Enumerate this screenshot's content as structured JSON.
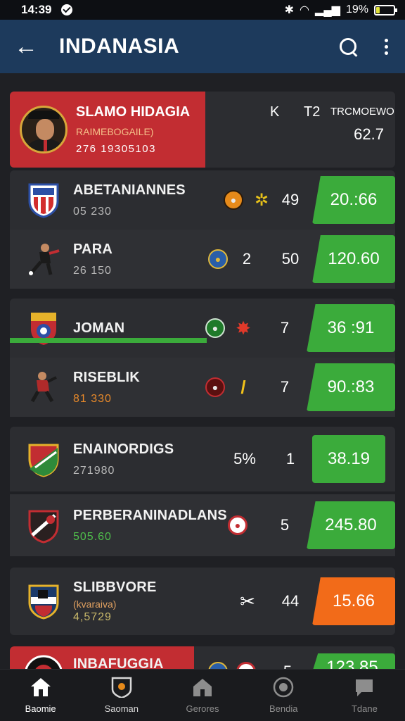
{
  "status_bar": {
    "time": "14:39",
    "battery": "19%",
    "battery_level": 0.19
  },
  "app_bar": {
    "title": "INDANASIA"
  },
  "hero": {
    "title": "SLAMO HIDAGIA",
    "subtitle": "RAIMEBOGAILE)",
    "number": "276 19305103",
    "col_1": "K",
    "col_2": "T2",
    "col_3": "TRCMOEWO",
    "value": "62.7"
  },
  "groups": [
    {
      "rows": [
        {
          "name": "ABETANIANNES",
          "sub": "05 230",
          "sub_color": "normal",
          "num": "49",
          "odds": "20.:66",
          "odds_color": "green"
        },
        {
          "name": "PARA",
          "sub": "26 150",
          "sub_color": "normal",
          "num_left": "2",
          "num": "50",
          "odds": "120.60",
          "odds_color": "green"
        }
      ]
    },
    {
      "rows": [
        {
          "name": "JOMAN",
          "sub": "",
          "sub_color": "normal",
          "num": "7",
          "odds": "36 :91",
          "odds_color": "green"
        },
        {
          "name": "RISEBLIK",
          "sub": "81 330",
          "sub_color": "orange",
          "num": "7",
          "odds": "90.:83",
          "odds_color": "green"
        }
      ]
    },
    {
      "rows": [
        {
          "name": "ENAINORDIGS",
          "sub": "271980",
          "sub_color": "normal",
          "pct": "5%",
          "num": "1",
          "odds": "38.19",
          "odds_color": "green"
        },
        {
          "name": "PERBERANINADLANS",
          "sub": "505.60",
          "sub_color": "green",
          "num": "5",
          "odds": "245.80",
          "odds_color": "green"
        }
      ]
    },
    {
      "rows": [
        {
          "name": "SLIBBVORE",
          "sub_small": "(kvaraiva)",
          "sub": "4,5729",
          "sub_color": "normal",
          "num": "44",
          "odds": "15.66",
          "odds_color": "orange"
        }
      ]
    },
    {
      "rows": [
        {
          "name": "INBAFUGGIA",
          "sub": "",
          "num": "5",
          "odds": "123.85",
          "odds_color": "green"
        }
      ]
    }
  ],
  "progress": {
    "row_1_fraction": 0.8,
    "row_3_fraction": 0.5
  },
  "bottom_nav": [
    {
      "label": "Baomie",
      "active": true
    },
    {
      "label": "Saoman",
      "active": false
    },
    {
      "label": "Gerores",
      "active": false
    },
    {
      "label": "Bendia",
      "active": false
    },
    {
      "label": "Tdane",
      "active": false
    }
  ],
  "colors": {
    "accent_green": "#3bab3b",
    "accent_orange": "#f26b19",
    "hero_red": "#c22d32",
    "app_bar": "#1d3a5c"
  }
}
